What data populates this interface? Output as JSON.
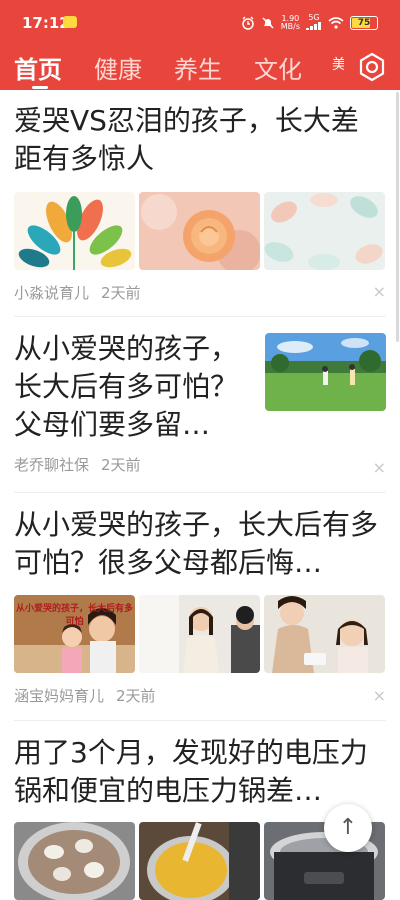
{
  "status_bar": {
    "time": "17:12",
    "net_speed_value": "1.90",
    "net_speed_unit": "MB/s",
    "signal_label": "5G",
    "battery": "75",
    "battery_level_percent": 75,
    "icons": [
      "alarm-icon",
      "mute-icon",
      "signal-icon",
      "wifi-icon",
      "battery-icon"
    ]
  },
  "tabs": {
    "items": [
      "首页",
      "健康",
      "养生",
      "文化"
    ],
    "active_index": 0,
    "overflow_partial": "美",
    "settings_icon": "gear-icon"
  },
  "feed": [
    {
      "title": "爱哭VS忍泪的孩子，长大差距有多惊人",
      "source": "小淼说育儿",
      "time": "2天前",
      "layout": "three-images"
    },
    {
      "title": "从小爱哭的孩子，长大后有多可怕？父母们要多留…",
      "source": "老乔聊社保",
      "time": "2天前",
      "layout": "right-image"
    },
    {
      "title": "从小爱哭的孩子，长大后有多可怕？很多父母都后悔…",
      "source": "涵宝妈妈育儿",
      "time": "2天前",
      "image_caption": "从小爱哭的孩子，长大后有多可怕",
      "layout": "three-images"
    },
    {
      "title": "用了3个月，发现好的电压力锅和便宜的电压力锅差…",
      "layout": "three-images"
    }
  ],
  "close_glyph": "×",
  "scroll_top_button": {
    "icon": "arrow-up-icon",
    "glyph": "↑"
  },
  "colors": {
    "header": "#e8453c",
    "active_tab": "#ffffff",
    "inactive_tab": "#ffd6d2",
    "meta_text": "#9a9a9a"
  }
}
